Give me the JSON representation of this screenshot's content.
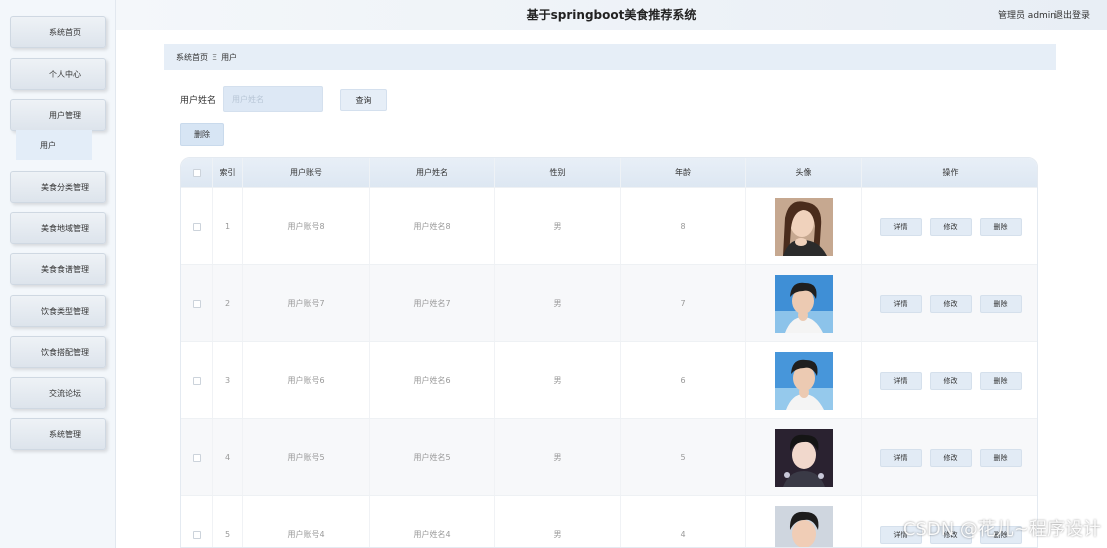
{
  "sidebar": {
    "items": [
      {
        "label": "系统首页"
      },
      {
        "label": "个人中心"
      },
      {
        "label": "用户管理"
      },
      {
        "label": "美食分类管理"
      },
      {
        "label": "美食地域管理"
      },
      {
        "label": "美食食谱管理"
      },
      {
        "label": "饮食类型管理"
      },
      {
        "label": "饮食搭配管理"
      },
      {
        "label": "交流论坛"
      },
      {
        "label": "系统管理"
      }
    ],
    "sub_item": "用户"
  },
  "header": {
    "title": "基于springboot美食推荐系统",
    "user": "管理员 admin",
    "logout": "退出登录"
  },
  "breadcrumb": {
    "home": "系统首页",
    "sep": "Ξ",
    "current": "用户"
  },
  "search": {
    "label": "用户姓名",
    "placeholder": "用户姓名",
    "query_label": "查询"
  },
  "toolbar": {
    "delete_label": "删除"
  },
  "table": {
    "headers": [
      "索引",
      "用户账号",
      "用户姓名",
      "性别",
      "年龄",
      "头像",
      "操作"
    ],
    "rows": [
      {
        "index": "1",
        "account": "用户账号8",
        "name": "用户姓名8",
        "gender": "男",
        "age": "8"
      },
      {
        "index": "2",
        "account": "用户账号7",
        "name": "用户姓名7",
        "gender": "男",
        "age": "7"
      },
      {
        "index": "3",
        "account": "用户账号6",
        "name": "用户姓名6",
        "gender": "男",
        "age": "6"
      },
      {
        "index": "4",
        "account": "用户账号5",
        "name": "用户姓名5",
        "gender": "男",
        "age": "5"
      },
      {
        "index": "5",
        "account": "用户账号4",
        "name": "用户姓名4",
        "gender": "男",
        "age": "4"
      }
    ],
    "actions": {
      "detail": "详情",
      "edit": "修改",
      "delete": "删除"
    }
  },
  "watermark": "CSDN @花儿~程序设计",
  "colors": {
    "accent": "#e3edf8",
    "button": "#e2ebf5",
    "header_bg": "#e6eef7"
  }
}
